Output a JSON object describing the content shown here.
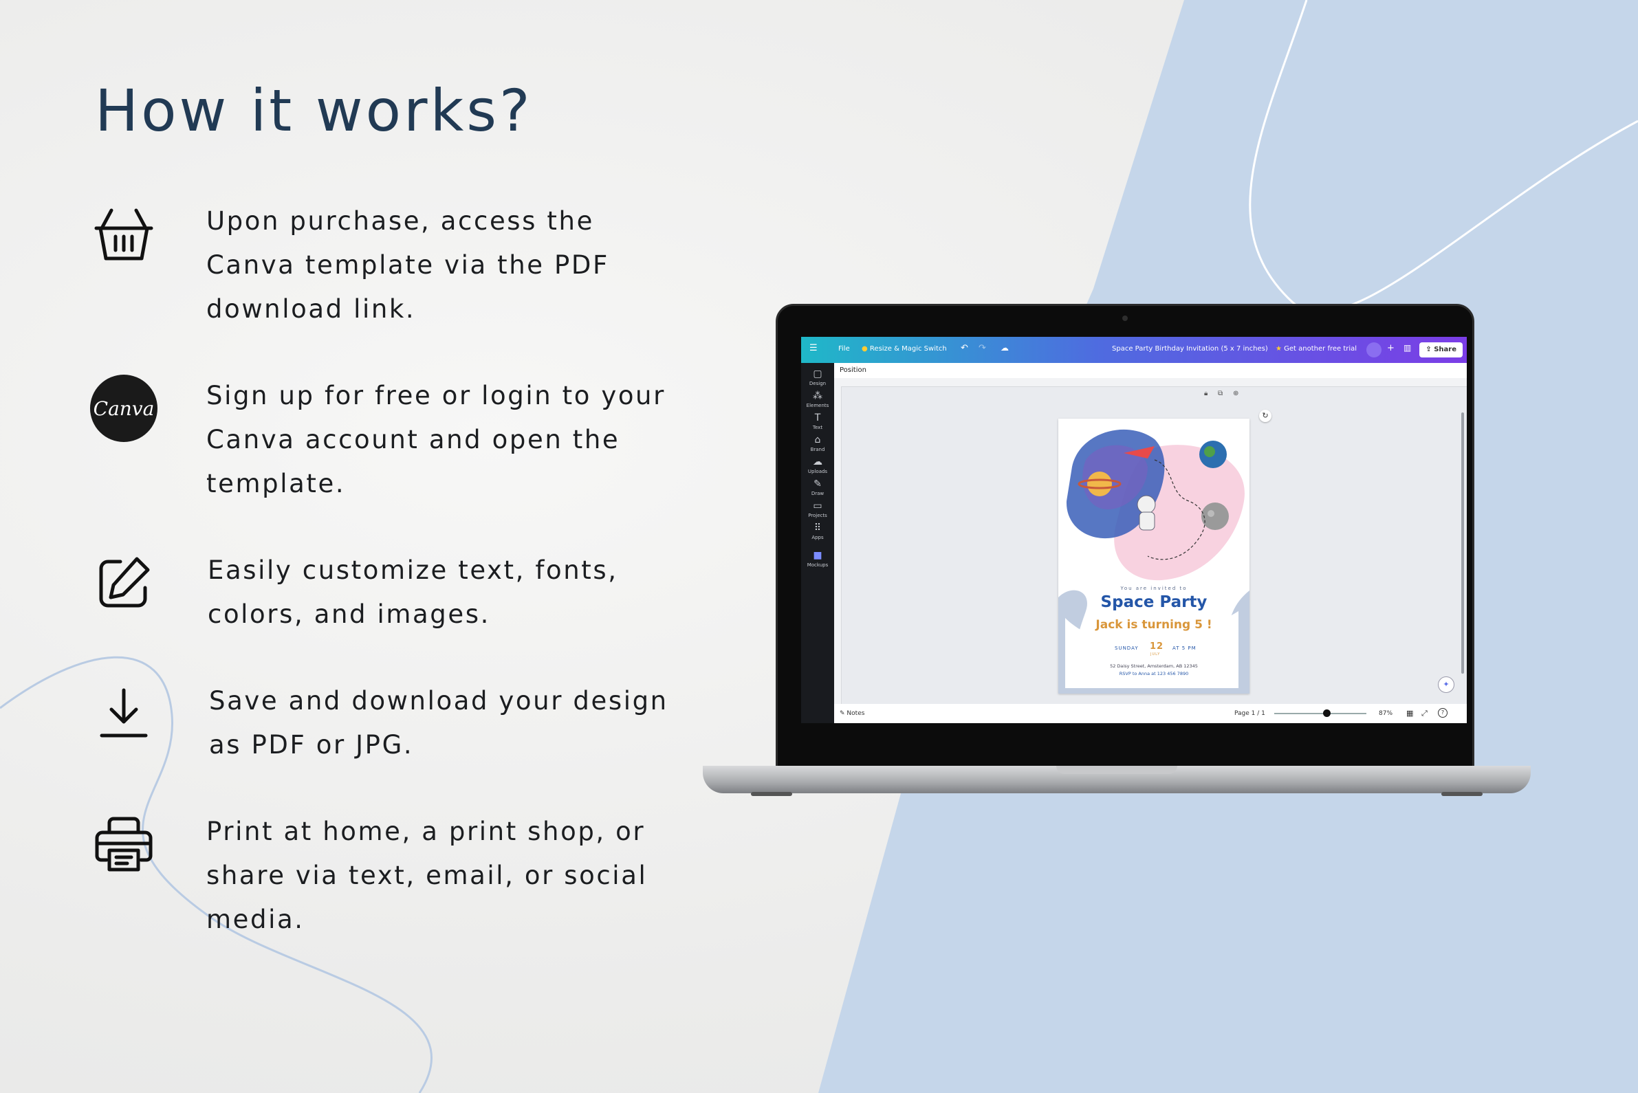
{
  "heading": "How it works?",
  "steps": [
    {
      "icon": "basket-icon",
      "text": "Upon purchase, access the Canva template via the PDF download link."
    },
    {
      "icon": "canva-logo",
      "badge": "Canva",
      "text": "Sign up for free or login to your Canva account and open the template."
    },
    {
      "icon": "edit-icon",
      "text": "Easily customize text, fonts, colors, and images."
    },
    {
      "icon": "download-icon",
      "text": "Save and download your design as PDF or JPG."
    },
    {
      "icon": "printer-icon",
      "text": "Print at home, a print shop, or share via text, email, or social media."
    }
  ],
  "editor": {
    "menu_file": "File",
    "resize_label": "Resize & Magic Switch",
    "doc_title": "Space Party Birthday Invitation (5 x 7 inches)",
    "trial_label": "Get another free trial",
    "share_label": "Share",
    "position_label": "Position",
    "sidebar": [
      "Design",
      "Elements",
      "Text",
      "Brand",
      "Uploads",
      "Draw",
      "Projects",
      "Apps",
      "Mockups"
    ],
    "notes_label": "Notes",
    "page_label": "Page 1 / 1",
    "zoom_label": "87%",
    "zoom_level_percent": 87
  },
  "invitation": {
    "invited": "You are invited to",
    "title": "Space Party",
    "subtitle": "Jack is turning 5 !",
    "day": "SUNDAY",
    "date_num": "12",
    "month": "JULY",
    "time": "AT 5 PM",
    "address": "52 Daisy Street, Amsterdam, AB 12345",
    "rsvp": "RSVP to Anna at 123 456 7890"
  },
  "colors": {
    "heading": "#213a54",
    "blue_shape": "#c5d6ea",
    "canva_bar_start": "#1fb8c8",
    "canva_bar_end": "#7b3de6",
    "invite_blue": "#2456a8",
    "invite_orange": "#d9963a"
  }
}
